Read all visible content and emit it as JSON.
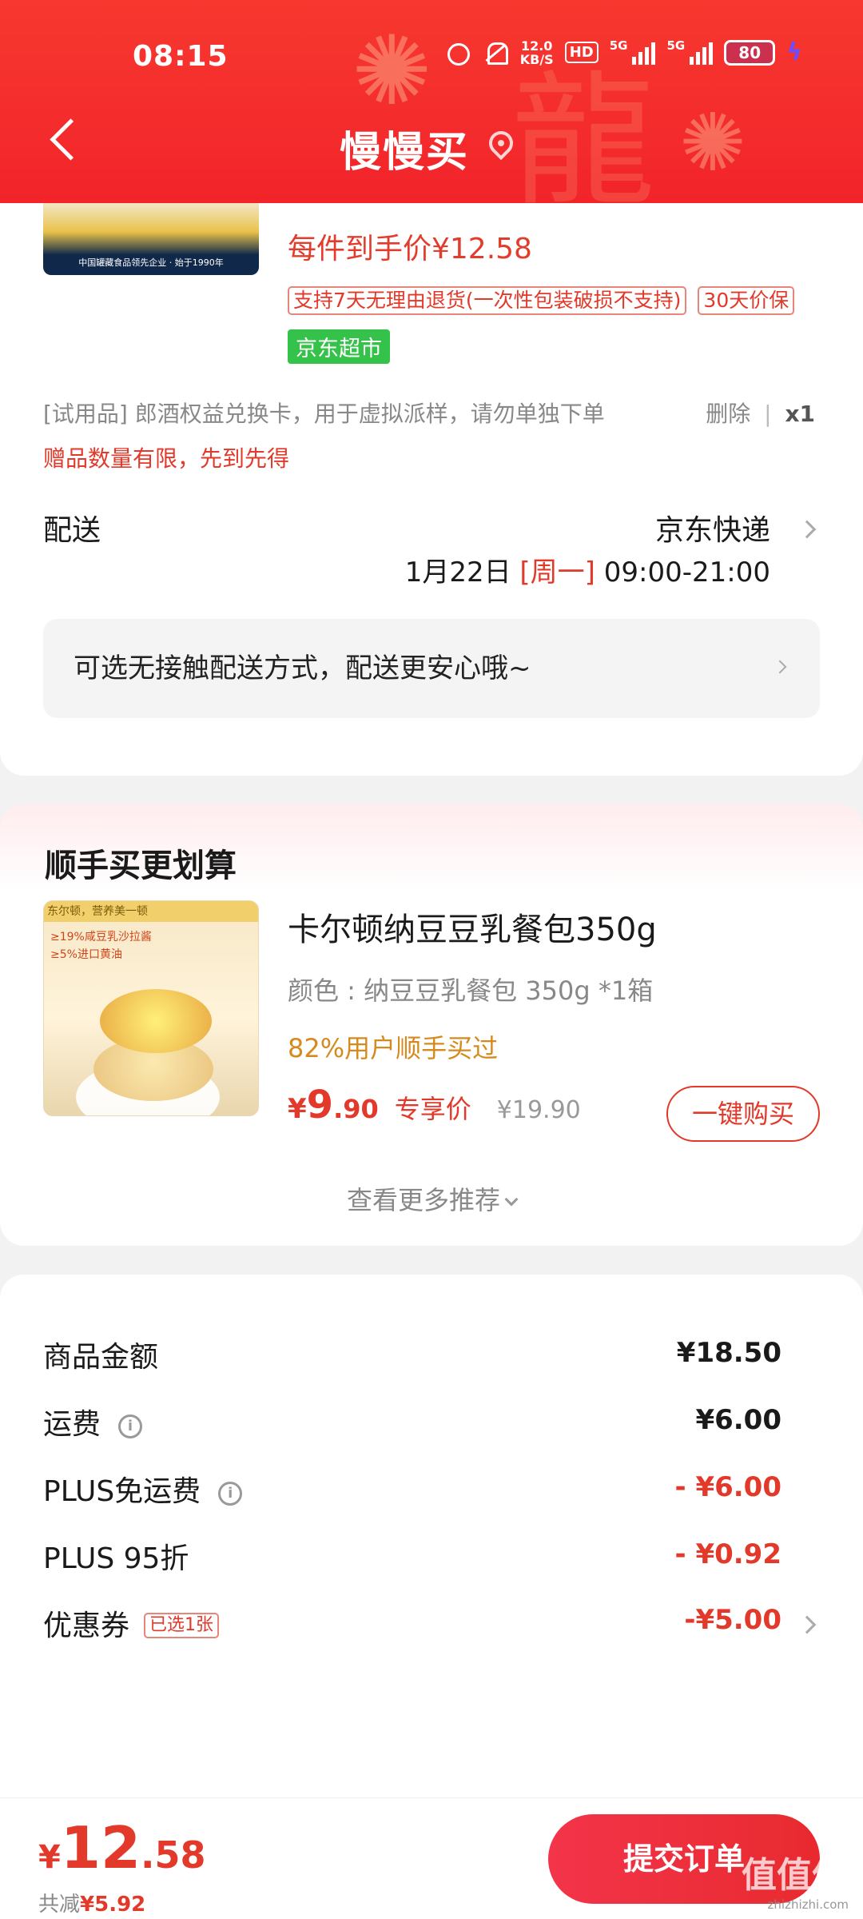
{
  "status": {
    "time": "08:15",
    "speed_value": "12.0",
    "speed_unit": "KB/S",
    "hd": "HD",
    "net1": "5G",
    "net2": "5G",
    "battery": "80"
  },
  "header": {
    "title": "慢慢买"
  },
  "product": {
    "unit_price": "每件到手价¥12.58",
    "return_tag": "支持7天无理由退货(一次性包装破损不支持)",
    "price_protect_tag": "30天价保",
    "store_tag": "京东超市",
    "image_caption": "中国罐藏食品领先企业 · 始于1990年"
  },
  "gift": {
    "label": "[试用品]  郎酒权益兑换卡，用于虚拟派样，请勿单独下单",
    "delete": "删除",
    "qty": "x1",
    "limit_text": "赠品数量有限，先到先得"
  },
  "shipping": {
    "label": "配送",
    "method": "京东快递",
    "date": "1月22日",
    "weekday": "[周一]",
    "time": "09:00-21:00",
    "contactless": "可选无接触配送方式，配送更安心哦~"
  },
  "recommend": {
    "title": "顺手买更划算",
    "image_banner": "东尔顿，营养美一顿",
    "image_line1": "≥19%咸豆乳沙拉酱",
    "image_line2": "≥5%进口黄油",
    "name": "卡尔顿纳豆豆乳餐包350g",
    "spec": "颜色 : 纳豆豆乳餐包 350g *1箱",
    "stat": "82%用户顺手买过",
    "price_symbol": "¥",
    "price_int": "9",
    "price_dec": ".90",
    "price_tag": "专享价",
    "original_price": "¥19.90",
    "buy_button": "一键购买",
    "more": "查看更多推荐"
  },
  "summary": [
    {
      "label": "商品金额",
      "value": "¥18.50"
    },
    {
      "label": "运费",
      "value": "¥6.00"
    },
    {
      "label": "PLUS免运费",
      "value": "- ¥6.00"
    },
    {
      "label": "PLUS 95折",
      "value": "- ¥0.92"
    },
    {
      "label": "优惠券",
      "tag": "已选1张",
      "value": "-¥5.00"
    }
  ],
  "bottom": {
    "total_symbol": "¥",
    "total_int": "12",
    "total_dec": ".58",
    "saved_label": "共减",
    "saved_value": "¥5.92",
    "submit": "提交订单",
    "watermark": "值值值",
    "watermark_url": "zhizhizhi.com"
  },
  "colors": {
    "brand_red": "#f2242a",
    "price_red": "#e2392a",
    "jd_green": "#35c24a",
    "orange": "#d68a1e"
  }
}
